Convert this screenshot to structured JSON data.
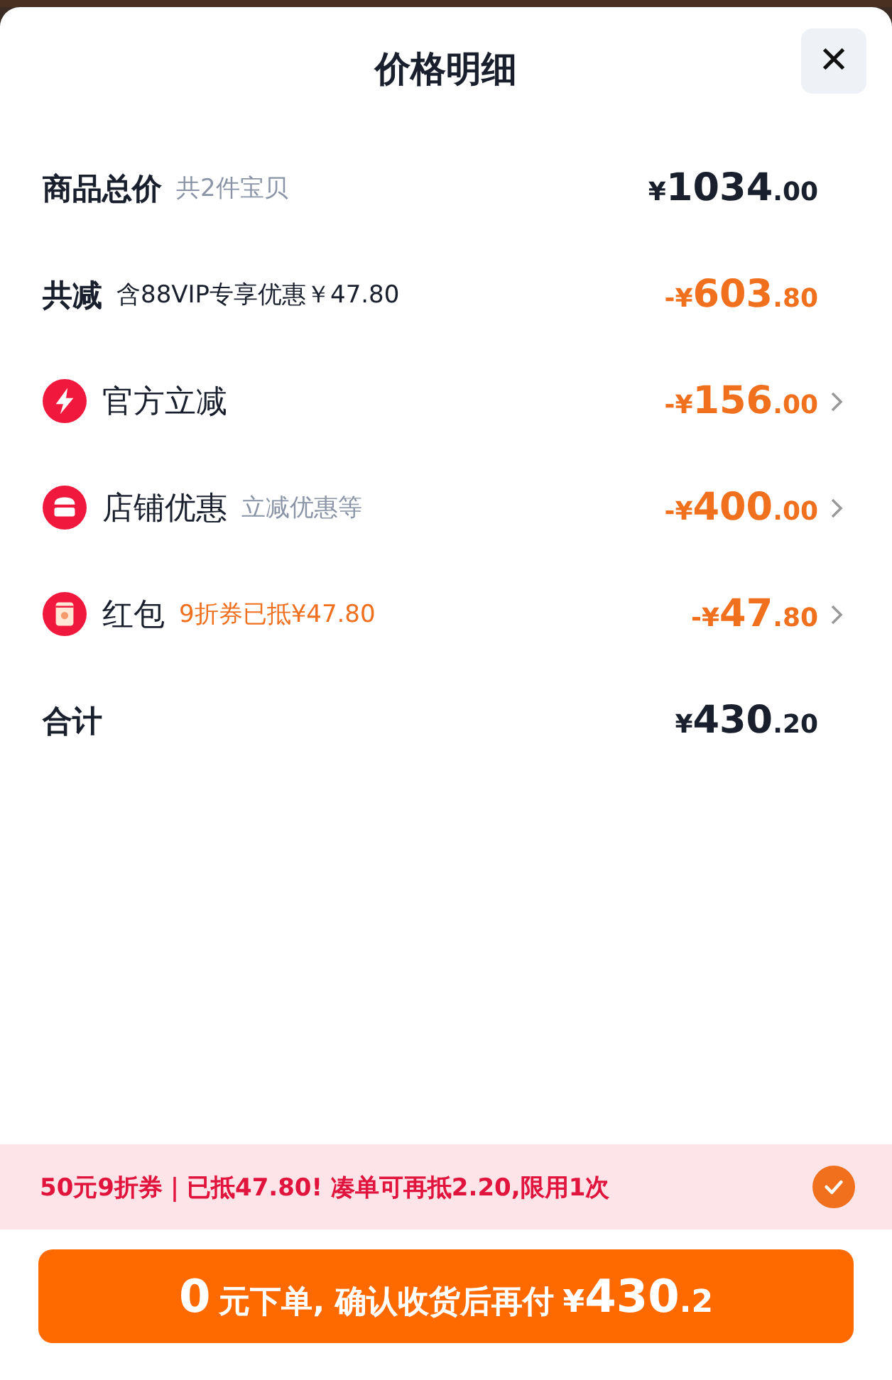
{
  "sheet": {
    "title": "价格明细",
    "close_label": "✕"
  },
  "rows": [
    {
      "kind": "plain",
      "label": "商品总价",
      "note": {
        "text": "共2件宝贝",
        "color": "#8a94a6"
      },
      "amount": {
        "currency": "¥",
        "integer": "1034",
        "decimal": ".00"
      },
      "discount": false,
      "chevron": false
    },
    {
      "kind": "plain",
      "label": "共减",
      "note": {
        "text": "含88VIP专享优惠￥47.80",
        "color": "#1a1f2e"
      },
      "amount": {
        "sign": "-",
        "currency": "¥",
        "integer": "603",
        "decimal": ".80"
      },
      "discount": true,
      "chevron": false
    },
    {
      "kind": "bolt",
      "label": "官方立减",
      "amount": {
        "sign": "-",
        "currency": "¥",
        "integer": "156",
        "decimal": ".00"
      },
      "discount": true,
      "chevron": true
    },
    {
      "kind": "store",
      "label": "店铺优惠",
      "note": {
        "text": "立减优惠等",
        "color": "#8a94a6"
      },
      "amount": {
        "sign": "-",
        "currency": "¥",
        "integer": "400",
        "decimal": ".00"
      },
      "discount": true,
      "chevron": true
    },
    {
      "kind": "packet",
      "label": "红包",
      "note": {
        "text": "9折券已抵¥47.80",
        "color": "#f07020"
      },
      "amount": {
        "sign": "-",
        "currency": "¥",
        "integer": "47",
        "decimal": ".80"
      },
      "discount": true,
      "chevron": true
    },
    {
      "kind": "plain",
      "label": "合计",
      "amount": {
        "currency": "¥",
        "integer": "430",
        "decimal": ".20"
      },
      "discount": false,
      "chevron": false
    }
  ],
  "coupon_bar": {
    "text": "50元9折券｜已抵47.80! 凑单可再抵2.20,限用1次",
    "checked": true
  },
  "pay_button": {
    "lead": "0",
    "middle": "元下单, 确认收货后再付",
    "currency": "¥",
    "integer": "430",
    "decimal": ".2"
  }
}
